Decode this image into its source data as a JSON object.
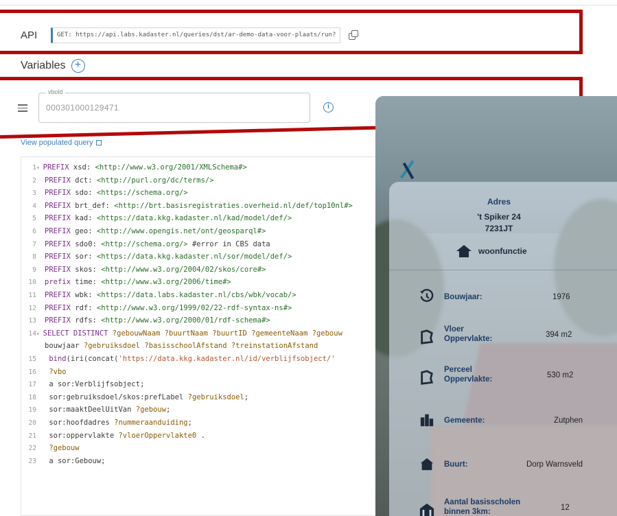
{
  "api": {
    "label": "API",
    "url": "GET: https://api.labs.kadaster.nl/queries/dst/ar-demo-data-voor-plaats/run?"
  },
  "variables": {
    "label": "Variables",
    "field_label": "vbold",
    "field_value": "000301000129471"
  },
  "links": {
    "view_populated_query": "View populated query"
  },
  "code": {
    "lines": [
      {
        "no": "1",
        "fold": true,
        "text": "PREFIX xsd: <http://www.w3.org/2001/XMLSchema#>"
      },
      {
        "no": "2",
        "text": "PREFIX dct: <http://purl.org/dc/terms/>"
      },
      {
        "no": "3",
        "text": "PREFIX sdo: <https://schema.org/>"
      },
      {
        "no": "4",
        "text": "PREFIX brt_def: <http://brt.basisregistraties.overheid.nl/def/top10nl#>"
      },
      {
        "no": "5",
        "text": "PREFIX kad: <https://data.kkg.kadaster.nl/kad/model/def/>"
      },
      {
        "no": "6",
        "text": "PREFIX geo: <http://www.opengis.net/ont/geosparql#>"
      },
      {
        "no": "7",
        "text": "PREFIX sdo0: <http://schema.org/> #error in CBS data"
      },
      {
        "no": "8",
        "text": "PREFIX sor: <https://data.kkg.kadaster.nl/sor/model/def/>"
      },
      {
        "no": "9",
        "text": "PREFIX skos: <http://www.w3.org/2004/02/skos/core#>"
      },
      {
        "no": "10",
        "text": "prefix time: <http://www.w3.org/2006/time#>"
      },
      {
        "no": "11",
        "text": "PREFIX wbk: <https://data.labs.kadaster.nl/cbs/wbk/vocab/>"
      },
      {
        "no": "12",
        "text": "PREFIX rdf: <http://www.w3.org/1999/02/22-rdf-syntax-ns#>"
      },
      {
        "no": "13",
        "text": "PREFIX rdfs: <http://www.w3.org/2000/01/rdf-schema#>"
      },
      {
        "no": "14",
        "fold": true,
        "text": "SELECT DISTINCT ?gebouwNaam ?buurtNaam ?buurtID ?gemeenteNaam ?gebouw"
      },
      {
        "no": "",
        "text": "bouwjaar ?gebruiksdoel ?basisschoolAfstand ?treinstationAfstand"
      },
      {
        "no": "15",
        "text": "  bind(iri(concat('https://data.kkg.kadaster.nl/id/verblijfsobject/'"
      },
      {
        "no": "16",
        "text": "  ?vbo"
      },
      {
        "no": "17",
        "text": "    a sor:Verblijfsobject;"
      },
      {
        "no": "18",
        "text": "    sor:gebruiksdoel/skos:prefLabel ?gebruiksdoel;"
      },
      {
        "no": "19",
        "text": "    sor:maaktDeelUitVan ?gebouw;"
      },
      {
        "no": "20",
        "text": "    sor:hoofdadres ?nummeraanduiding;"
      },
      {
        "no": "21",
        "text": "    sor:oppervlakte ?vloerOppervlakte0 ."
      },
      {
        "no": "22",
        "text": "  ?gebouw"
      },
      {
        "no": "23",
        "text": "    a sor:Gebouw;"
      }
    ]
  },
  "card": {
    "adres_title": "Adres",
    "street": "'t Spiker 24",
    "postcode": "7231JT",
    "functie": "woonfunctie",
    "bouwjaar_label": "Bouwjaar:",
    "bouwjaar_value": "1976",
    "vloer_label_1": "Vloer",
    "vloer_label_2": "Oppervlakte:",
    "vloer_value": "394 m2",
    "perceel_label_1": "Perceel",
    "perceel_label_2": "Oppervlakte:",
    "perceel_value": "530 m2",
    "gemeente_label": "Gemeente:",
    "gemeente_value": "Zutphen",
    "buurt_label": "Buurt:",
    "buurt_value": "Dorp Warnsveld",
    "scholen_label_1": "Aantal basisscholen",
    "scholen_label_2": "binnen 3km:",
    "scholen_value": "12"
  },
  "colors": {
    "accent": "#3d7fc3",
    "highlight": "#b20a0a",
    "card_text": "#1e3d66"
  }
}
